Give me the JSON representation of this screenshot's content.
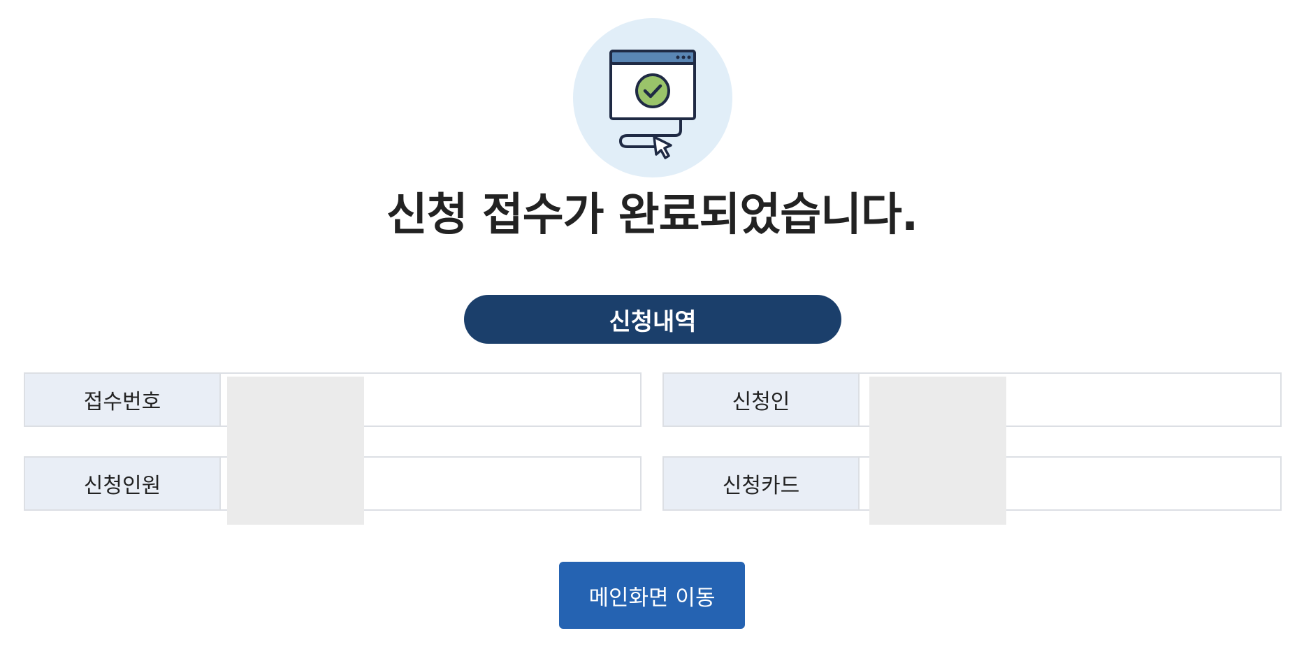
{
  "hero": {
    "icon": "monitor-check-cursor-icon",
    "title": "신청 접수가 완료되었습니다."
  },
  "summary": {
    "heading": "신청내역",
    "fields": [
      {
        "label": "접수번호",
        "value": ""
      },
      {
        "label": "신청인",
        "value": ""
      },
      {
        "label": "신청인원",
        "value": ""
      },
      {
        "label": "신청카드",
        "value": ""
      }
    ]
  },
  "actions": {
    "main_button_label": "메인화면 이동"
  },
  "colors": {
    "pill_bg": "#1b3f6b",
    "button_bg": "#2563b2",
    "label_bg": "#e9eef6",
    "hero_circle_bg": "#e1eef8",
    "check_green": "#9ac46a"
  }
}
